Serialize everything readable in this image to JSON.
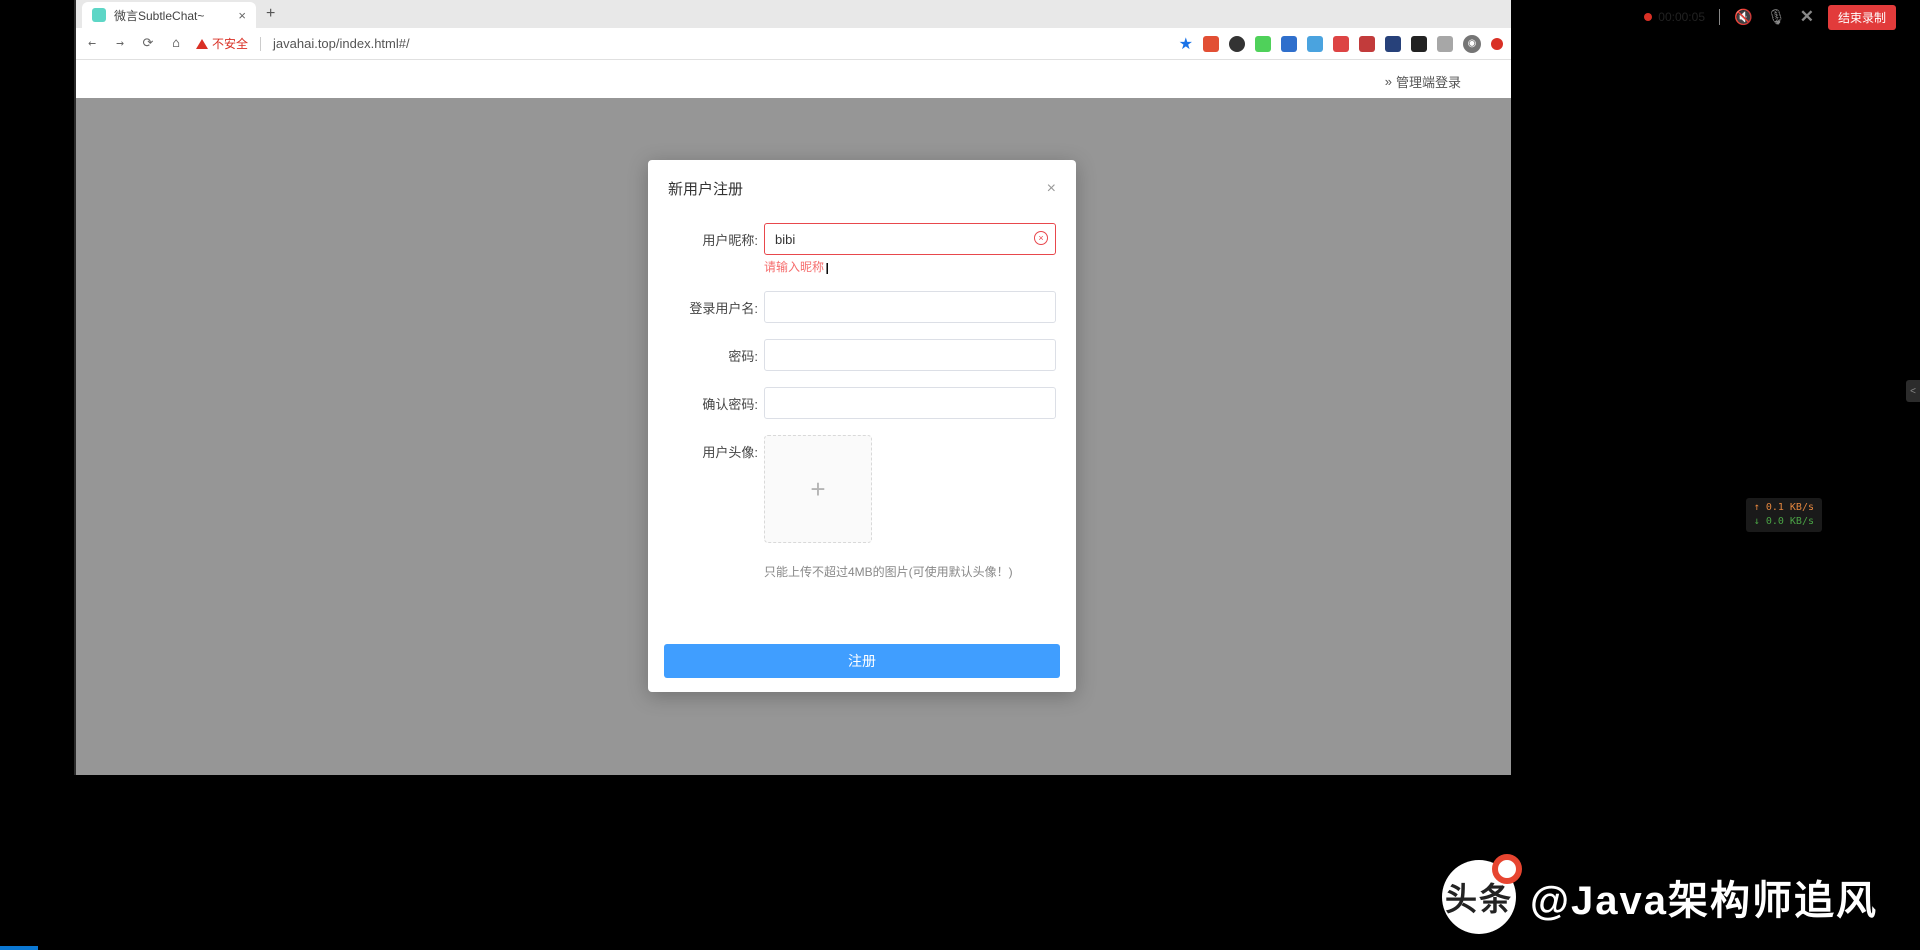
{
  "tab": {
    "title": "微言SubtleChat~"
  },
  "address": {
    "security_label": "不安全",
    "url": "javahai.top/index.html#/"
  },
  "recording": {
    "time": "00:00:05",
    "end_label": "结束录制"
  },
  "page": {
    "admin_login": "管理端登录"
  },
  "modal": {
    "title": "新用户注册",
    "fields": {
      "nickname": {
        "label": "用户昵称:",
        "value": "bibi",
        "error": "请输入昵称"
      },
      "username": {
        "label": "登录用户名:",
        "value": ""
      },
      "password": {
        "label": "密码:",
        "value": ""
      },
      "confirm": {
        "label": "确认密码:",
        "value": ""
      },
      "avatar": {
        "label": "用户头像:",
        "hint": "只能上传不超过4MB的图片(可使用默认头像！)"
      }
    },
    "submit": "注册"
  },
  "network": {
    "up": "↑ 0.1 KB/s",
    "down": "↓ 0.0 KB/s"
  },
  "watermark": "@Java架构师追风"
}
